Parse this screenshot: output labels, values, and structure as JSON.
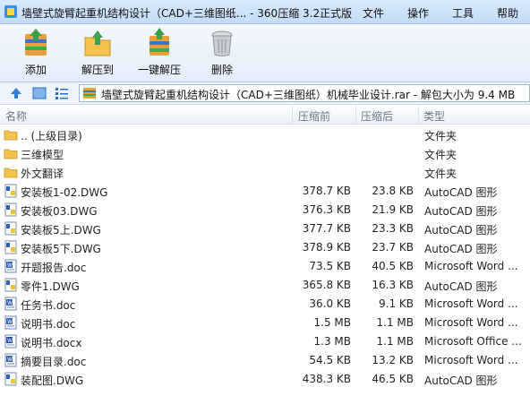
{
  "window": {
    "title": "墙壁式旋臂起重机结构设计（CAD+三维图纸... - 360压缩 3.2正式版",
    "menu": [
      {
        "label": "文件"
      },
      {
        "label": "操作"
      },
      {
        "label": "工具"
      },
      {
        "label": "帮助"
      }
    ]
  },
  "toolbar": {
    "buttons": [
      {
        "label": "添加",
        "icon": "add-archive-icon"
      },
      {
        "label": "解压到",
        "icon": "extract-to-icon"
      },
      {
        "label": "一键解压",
        "icon": "one-click-extract-icon"
      },
      {
        "label": "删除",
        "icon": "trash-icon"
      }
    ]
  },
  "addressbar": {
    "path": "墙壁式旋臂起重机结构设计（CAD+三维图纸）机械毕业设计.rar - 解包大小为 9.4 MB"
  },
  "columns": {
    "name": "名称",
    "packed": "压缩前",
    "size": "压缩后",
    "type": "类型"
  },
  "files": [
    {
      "name": ".. (上级目录)",
      "packed": "",
      "size": "",
      "type": "文件夹",
      "icon": "folder-icon"
    },
    {
      "name": "三维模型",
      "packed": "",
      "size": "",
      "type": "文件夹",
      "icon": "folder-icon"
    },
    {
      "name": "外文翻译",
      "packed": "",
      "size": "",
      "type": "文件夹",
      "icon": "folder-icon"
    },
    {
      "name": "安装板1-02.DWG",
      "packed": "378.7 KB",
      "size": "23.8 KB",
      "type": "AutoCAD 图形",
      "icon": "dwg-file-icon"
    },
    {
      "name": "安装板03.DWG",
      "packed": "376.3 KB",
      "size": "21.9 KB",
      "type": "AutoCAD 图形",
      "icon": "dwg-file-icon"
    },
    {
      "name": "安装板5上.DWG",
      "packed": "377.7 KB",
      "size": "23.3 KB",
      "type": "AutoCAD 图形",
      "icon": "dwg-file-icon"
    },
    {
      "name": "安装板5下.DWG",
      "packed": "378.9 KB",
      "size": "23.7 KB",
      "type": "AutoCAD 图形",
      "icon": "dwg-file-icon"
    },
    {
      "name": "开题报告.doc",
      "packed": "73.5 KB",
      "size": "40.5 KB",
      "type": "Microsoft Word ...",
      "icon": "word-doc-icon"
    },
    {
      "name": "零件1.DWG",
      "packed": "365.8 KB",
      "size": "16.3 KB",
      "type": "AutoCAD 图形",
      "icon": "dwg-file-icon"
    },
    {
      "name": "任务书.doc",
      "packed": "36.0 KB",
      "size": "9.1 KB",
      "type": "Microsoft Word ...",
      "icon": "word-doc-icon"
    },
    {
      "name": "说明书.doc",
      "packed": "1.5 MB",
      "size": "1.1 MB",
      "type": "Microsoft Word ...",
      "icon": "word-doc-icon"
    },
    {
      "name": "说明书.docx",
      "packed": "1.3 MB",
      "size": "1.1 MB",
      "type": "Microsoft Office ...",
      "icon": "word-docx-icon"
    },
    {
      "name": "摘要目录.doc",
      "packed": "54.5 KB",
      "size": "13.2 KB",
      "type": "Microsoft Word ...",
      "icon": "word-doc-icon"
    },
    {
      "name": "装配图.DWG",
      "packed": "438.3 KB",
      "size": "46.5 KB",
      "type": "AutoCAD 图形",
      "icon": "dwg-file-icon"
    }
  ]
}
